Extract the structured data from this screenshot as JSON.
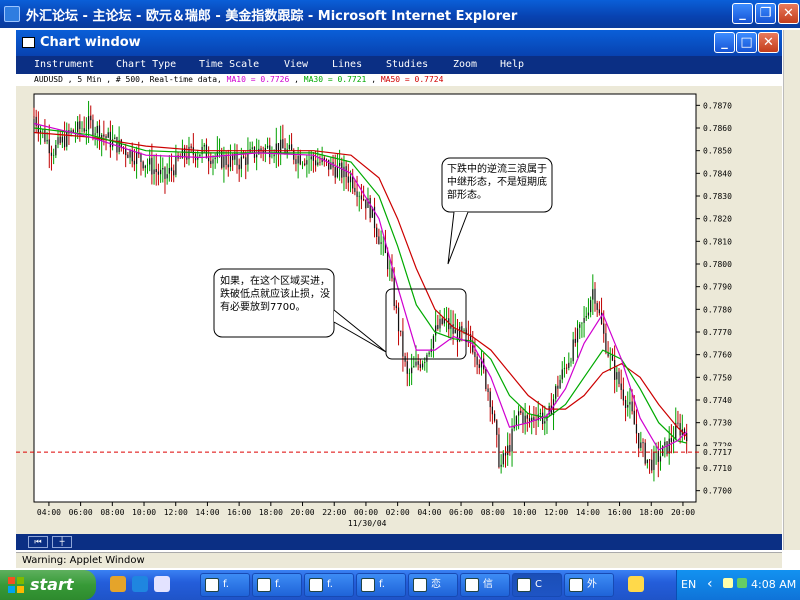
{
  "browser": {
    "title": "外汇论坛 - 主论坛 - 欧元＆瑞郎 - 美金指数跟踪 - Microsoft Internet Explorer",
    "min": "_",
    "restore": "❐",
    "close": "✕"
  },
  "chart_window": {
    "title": "Chart window",
    "menu": [
      "Instrument",
      "Chart Type",
      "Time Scale",
      "View",
      "Lines",
      "Studies",
      "Zoom",
      "Help"
    ],
    "info": "AUDUSD , 5 Min , # 500, Real-time data",
    "ma10": "MA10 = 0.7726",
    "ma30": "MA30 = 0.7721",
    "ma50": "MA50 = 0.7724",
    "date_label": "11/30/04",
    "current_price": "0.7717"
  },
  "annotations": {
    "left": "如果，在这个区域买进，跌破低点就应该止损，没有必要放到7700。",
    "right": "下跌中的逆流三浪属于中继形态，不是短期底部形态。"
  },
  "applet_warning": "Warning: Applet Window",
  "taskbar": {
    "start": "start",
    "buttons": [
      "f.",
      "f.",
      "f.",
      "f.",
      "恋",
      "信",
      "C",
      "外"
    ],
    "lang": "EN",
    "clock": "4:08 AM"
  },
  "chart_data": {
    "type": "line",
    "instrument": "AUDUSD",
    "interval": "5 Min",
    "x_ticks": [
      "04:00",
      "06:00",
      "08:00",
      "10:00",
      "12:00",
      "14:00",
      "16:00",
      "18:00",
      "20:00",
      "22:00",
      "00:00",
      "02:00",
      "04:00",
      "06:00",
      "08:00",
      "10:00",
      "12:00",
      "14:00",
      "16:00",
      "18:00",
      "20:00"
    ],
    "y_ticks": [
      "0.7870",
      "0.7860",
      "0.7850",
      "0.7840",
      "0.7830",
      "0.7820",
      "0.7810",
      "0.7800",
      "0.7790",
      "0.7780",
      "0.7770",
      "0.7760",
      "0.7750",
      "0.7740",
      "0.7730",
      "0.7720",
      "0.7710",
      "0.7700"
    ],
    "ylim": [
      0.7695,
      0.7875
    ],
    "price_path": [
      [
        0,
        0.7865
      ],
      [
        1,
        0.785
      ],
      [
        2,
        0.7858
      ],
      [
        3,
        0.7862
      ],
      [
        4,
        0.7855
      ],
      [
        5,
        0.785
      ],
      [
        6,
        0.7845
      ],
      [
        7,
        0.7838
      ],
      [
        8,
        0.7848
      ],
      [
        9,
        0.785
      ],
      [
        10,
        0.7846
      ],
      [
        11,
        0.7845
      ],
      [
        12,
        0.785
      ],
      [
        13,
        0.7852
      ],
      [
        14,
        0.7848
      ],
      [
        15,
        0.7846
      ],
      [
        16,
        0.7843
      ],
      [
        17,
        0.7838
      ],
      [
        18,
        0.7825
      ],
      [
        18.5,
        0.7812
      ],
      [
        19,
        0.78
      ],
      [
        19.5,
        0.7775
      ],
      [
        20,
        0.775
      ],
      [
        20.5,
        0.7755
      ],
      [
        21,
        0.776
      ],
      [
        21.5,
        0.777
      ],
      [
        22,
        0.7775
      ],
      [
        22.5,
        0.777
      ],
      [
        23,
        0.7768
      ],
      [
        23.5,
        0.7765
      ],
      [
        24,
        0.7755
      ],
      [
        24.5,
        0.774
      ],
      [
        25,
        0.771
      ],
      [
        25.5,
        0.772
      ],
      [
        26,
        0.7735
      ],
      [
        26.5,
        0.773
      ],
      [
        27,
        0.7735
      ],
      [
        27.5,
        0.773
      ],
      [
        28,
        0.7745
      ],
      [
        28.5,
        0.7755
      ],
      [
        29,
        0.7765
      ],
      [
        29.5,
        0.7775
      ],
      [
        30,
        0.779
      ],
      [
        30.5,
        0.777
      ],
      [
        31,
        0.7755
      ],
      [
        31.5,
        0.7745
      ],
      [
        32,
        0.7735
      ],
      [
        32.5,
        0.772
      ],
      [
        33,
        0.7712
      ],
      [
        33.5,
        0.7715
      ],
      [
        34,
        0.772
      ],
      [
        34.5,
        0.7728
      ],
      [
        35,
        0.7726
      ]
    ],
    "ma10": [
      [
        0,
        0.7862
      ],
      [
        3,
        0.7856
      ],
      [
        6,
        0.7848
      ],
      [
        9,
        0.7847
      ],
      [
        12,
        0.7849
      ],
      [
        15,
        0.7848
      ],
      [
        17,
        0.784
      ],
      [
        18.5,
        0.782
      ],
      [
        19.5,
        0.779
      ],
      [
        20.5,
        0.7762
      ],
      [
        21.5,
        0.7762
      ],
      [
        22.5,
        0.7768
      ],
      [
        23.5,
        0.7765
      ],
      [
        24.5,
        0.775
      ],
      [
        25.5,
        0.7728
      ],
      [
        26.5,
        0.773
      ],
      [
        27.5,
        0.7733
      ],
      [
        28.5,
        0.7745
      ],
      [
        29.5,
        0.7765
      ],
      [
        30.5,
        0.7778
      ],
      [
        31.5,
        0.7758
      ],
      [
        32.5,
        0.7732
      ],
      [
        33.5,
        0.7718
      ],
      [
        34.5,
        0.7722
      ],
      [
        35,
        0.7726
      ]
    ],
    "ma30": [
      [
        0,
        0.786
      ],
      [
        3,
        0.7857
      ],
      [
        6,
        0.785
      ],
      [
        9,
        0.7849
      ],
      [
        12,
        0.7849
      ],
      [
        15,
        0.7849
      ],
      [
        17,
        0.7845
      ],
      [
        18.5,
        0.783
      ],
      [
        19.5,
        0.7808
      ],
      [
        20.5,
        0.7782
      ],
      [
        21.5,
        0.777
      ],
      [
        22.5,
        0.7767
      ],
      [
        23.5,
        0.7766
      ],
      [
        24.5,
        0.7758
      ],
      [
        25.5,
        0.7742
      ],
      [
        26.5,
        0.7734
      ],
      [
        27.5,
        0.7732
      ],
      [
        28.5,
        0.7738
      ],
      [
        29.5,
        0.775
      ],
      [
        30.5,
        0.7762
      ],
      [
        31.5,
        0.7758
      ],
      [
        32.5,
        0.7745
      ],
      [
        33.5,
        0.773
      ],
      [
        34.5,
        0.7722
      ],
      [
        35,
        0.7721
      ]
    ],
    "ma50": [
      [
        0,
        0.7858
      ],
      [
        3,
        0.7856
      ],
      [
        6,
        0.7852
      ],
      [
        9,
        0.785
      ],
      [
        12,
        0.785
      ],
      [
        15,
        0.785
      ],
      [
        17,
        0.7848
      ],
      [
        18.5,
        0.7838
      ],
      [
        19.5,
        0.782
      ],
      [
        20.5,
        0.7798
      ],
      [
        21.5,
        0.778
      ],
      [
        22.5,
        0.7772
      ],
      [
        23.5,
        0.7768
      ],
      [
        24.5,
        0.7762
      ],
      [
        25.5,
        0.7752
      ],
      [
        26.5,
        0.7742
      ],
      [
        27.5,
        0.7736
      ],
      [
        28.5,
        0.7736
      ],
      [
        29.5,
        0.7742
      ],
      [
        30.5,
        0.7752
      ],
      [
        31.5,
        0.7756
      ],
      [
        32.5,
        0.775
      ],
      [
        33.5,
        0.7738
      ],
      [
        34.5,
        0.7728
      ],
      [
        35,
        0.7724
      ]
    ],
    "hline": 0.7717,
    "colors": {
      "price": "#1a1a1a",
      "ma10": "#d000d0",
      "ma30": "#00aa00",
      "ma50": "#cc0000",
      "hline": "#dd0000",
      "up": "#00a000",
      "down": "#c00000"
    }
  }
}
